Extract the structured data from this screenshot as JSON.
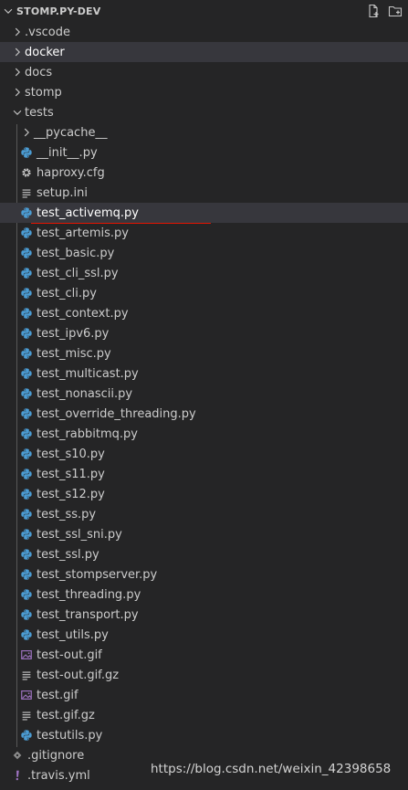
{
  "explorer": {
    "project_title": "STOMP.PY-DEV"
  },
  "tree": {
    "folders": {
      "vscode": ".vscode",
      "docker": "docker",
      "docs": "docs",
      "stomp": "stomp",
      "tests": "tests"
    },
    "tests_children": {
      "pycache": "__pycache__",
      "init_py": "__init__.py",
      "haproxy_cfg": "haproxy.cfg",
      "setup_ini": "setup.ini",
      "test_activemq": "test_activemq.py",
      "test_artemis": "test_artemis.py",
      "test_basic": "test_basic.py",
      "test_cli_ssl": "test_cli_ssl.py",
      "test_cli": "test_cli.py",
      "test_context": "test_context.py",
      "test_ipv6": "test_ipv6.py",
      "test_misc": "test_misc.py",
      "test_multicast": "test_multicast.py",
      "test_nonascii": "test_nonascii.py",
      "test_override_threading": "test_override_threading.py",
      "test_rabbitmq": "test_rabbitmq.py",
      "test_s10": "test_s10.py",
      "test_s11": "test_s11.py",
      "test_s12": "test_s12.py",
      "test_ss": "test_ss.py",
      "test_ssl_sni": "test_ssl_sni.py",
      "test_ssl": "test_ssl.py",
      "test_stompserver": "test_stompserver.py",
      "test_threading": "test_threading.py",
      "test_transport": "test_transport.py",
      "test_utils": "test_utils.py",
      "test_out_gif": "test-out.gif",
      "test_out_gif_gz": "test-out.gif.gz",
      "test_gif": "test.gif",
      "test_gif_gz": "test.gif.gz",
      "testutils": "testutils.py"
    },
    "root_files": {
      "gitignore": ".gitignore",
      "travis": ".travis.yml"
    }
  },
  "watermark": "https://blog.csdn.net/weixin_42398658",
  "colors": {
    "background": "#252526",
    "selected_row": "#37373d",
    "annotation_underline": "#e51400",
    "python_icon": "#4b9cd3",
    "image_icon": "#a074c4",
    "yaml_icon": "#a074c4"
  },
  "icons": {
    "header_chevron": "chevron-down-icon",
    "new_file": "new-file-icon",
    "new_folder": "new-folder-icon",
    "collapsed": "chevron-right-icon",
    "expanded": "chevron-down-icon",
    "python": "python-file-icon",
    "gear": "gear-icon",
    "lines": "text-file-icon",
    "image": "image-file-icon",
    "diamond": "git-icon",
    "exclamation": "yaml-icon"
  }
}
